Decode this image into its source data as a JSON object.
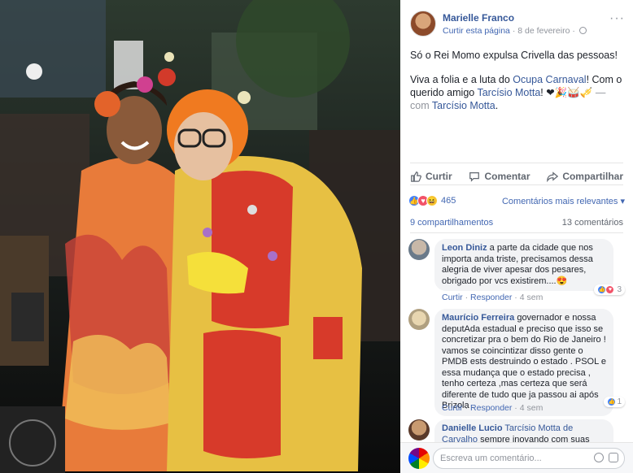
{
  "post": {
    "author": "Marielle Franco",
    "like_page": "Curtir esta página",
    "separator": "·",
    "date": "8 de fevereiro",
    "more": "···",
    "line1": "Só o Rei Momo expulsa Crivella das pessoas!",
    "line2_a": "Viva a folia e a luta do ",
    "line2_link": "Ocupa Carnaval",
    "line2_b": "! Com o querido amigo ",
    "line2_tag": "Tarcísio Motta",
    "line2_c": "! ",
    "emojis": "❤🎉🥁🎺",
    "with": " — com ",
    "with_name": "Tarcísio Motta",
    "period": "."
  },
  "actions": {
    "like": "Curtir",
    "comment": "Comentar",
    "share": "Compartilhar"
  },
  "reactions": {
    "count": "465",
    "sort": "Comentários mais relevantes ▾",
    "shares": "9 compartilhamentos",
    "comments": "13 comentários"
  },
  "comments": [
    {
      "name": "Leon Diniz",
      "text": " a parte da cidade que nos importa anda triste, precisamos dessa alegria de viver apesar dos pesares, obrigado por vcs existirem....😍",
      "like": "Curtir",
      "reply": "Responder",
      "time": "4 sem",
      "reacts": "3"
    },
    {
      "name": "Maurício Ferreira",
      "text": " governador e nossa deputAda estadual e preciso que isso se concretizar pra o bem do Rio de Janeiro ! vamos se coincintizar disso gente o PMDB ests destruindo o estado . PSOL e essa mudança que o estado precisa , tenho certeza ,mas certeza que será diferente de tudo que ja passou ai após Brizola .",
      "like": "Curtir",
      "reply": "Responder",
      "time": "4 sem",
      "reacts": "1"
    },
    {
      "name": "Danielle Lucio",
      "tag": " Tarcísio Motta de Carvalho",
      "text": " sempre inovando com suas fantasias"
    }
  ],
  "composer": {
    "placeholder": "Escreva um comentário..."
  },
  "icons": {
    "like": "thumbs-up-icon",
    "comment": "speech-bubble-icon",
    "share": "share-arrow-icon",
    "globe": "globe-icon"
  },
  "colors": {
    "link": "#365899",
    "accent": "#4267b2",
    "muted": "#90949c"
  }
}
